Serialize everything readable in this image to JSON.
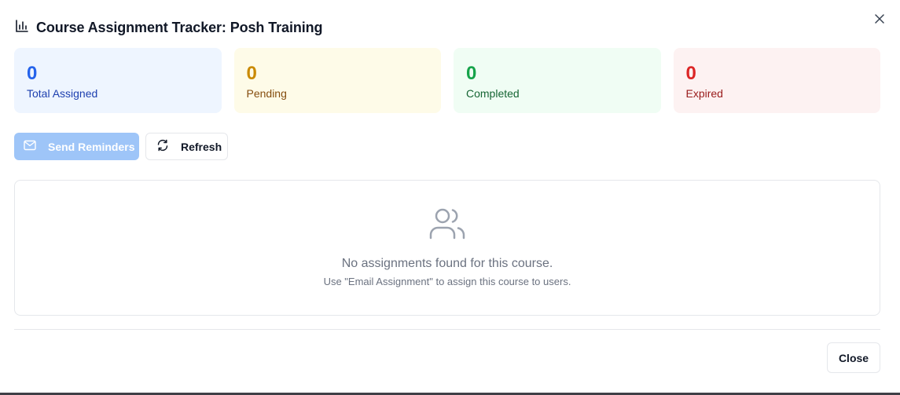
{
  "dialog": {
    "title": "Course Assignment Tracker: Posh Training",
    "title_icon": "bar-chart-icon",
    "close_icon": "close-icon"
  },
  "stats": [
    {
      "key": "total",
      "value": "0",
      "label": "Total Assigned",
      "color": "#2563eb"
    },
    {
      "key": "pending",
      "value": "0",
      "label": "Pending",
      "color": "#ca8a04"
    },
    {
      "key": "completed",
      "value": "0",
      "label": "Completed",
      "color": "#16a34a"
    },
    {
      "key": "expired",
      "value": "0",
      "label": "Expired",
      "color": "#dc2626"
    }
  ],
  "actions": {
    "send_reminders": {
      "label": "Send Reminders",
      "icon": "mail-icon",
      "disabled": true
    },
    "refresh": {
      "label": "Refresh",
      "icon": "refresh-icon"
    }
  },
  "empty_state": {
    "icon": "users-icon",
    "message": "No assignments found for this course.",
    "hint": "Use \"Email Assignment\" to assign this course to users."
  },
  "footer": {
    "close_label": "Close"
  }
}
